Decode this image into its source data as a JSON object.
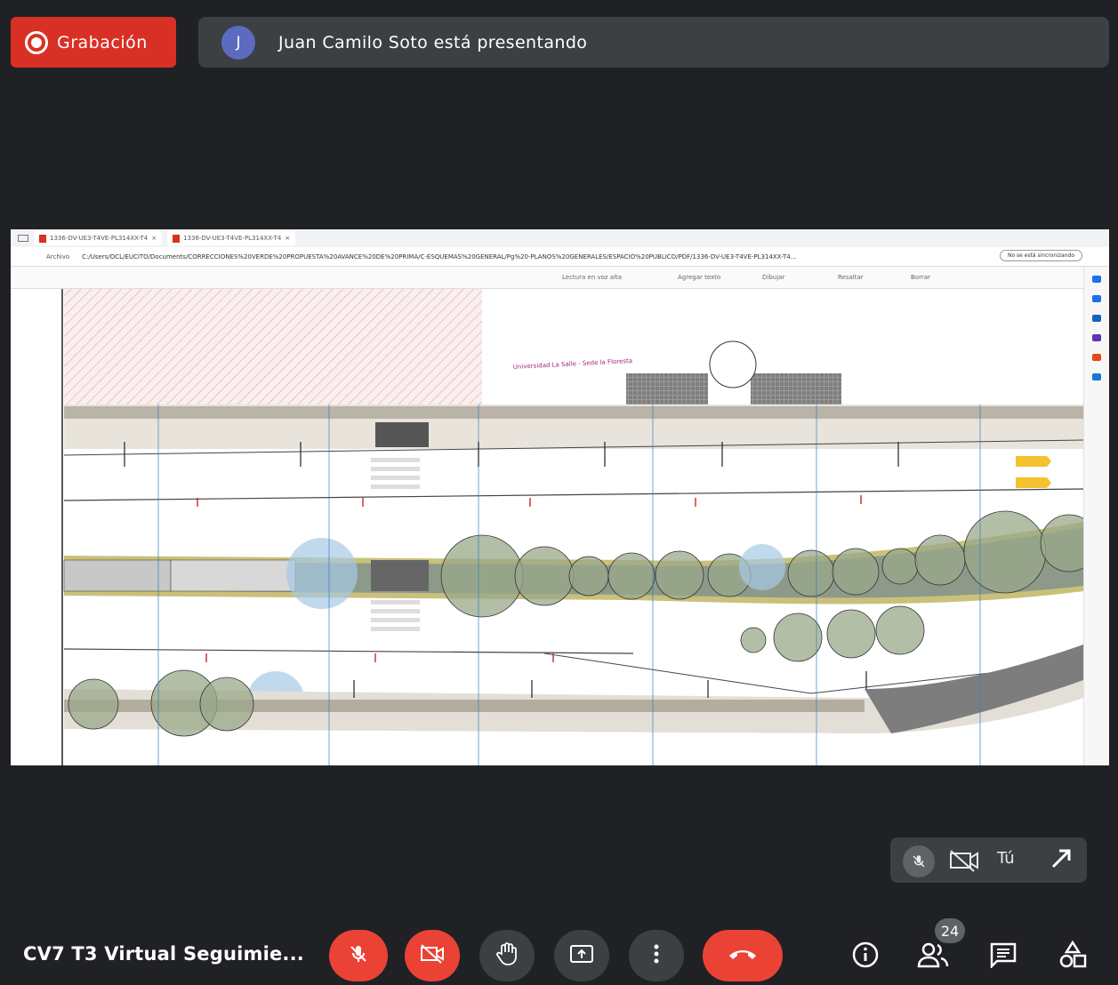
{
  "recording": {
    "label": "Grabación"
  },
  "presenter": {
    "avatar_letter": "J",
    "text": "Juan Camilo Soto está presentando"
  },
  "shared_screen": {
    "tabs": [
      {
        "label": "1336-DV-UE3-T4VE-PL314XX-T4"
      },
      {
        "label": "1336-DV-UE3-T4VE-PL314XX-T4"
      }
    ],
    "address": {
      "scheme": "Archivo",
      "url": "C:/Users/OCL/EUCITO/Documents/CORRECCIONES%20VERDE%20PROPUESTA%20AVANCE%20DE%20PRIMA/C-ESQUEMAS%20GENERAL/Pg%20-PLANOS%20GENERALES/ESPACIO%20PUBLICO/PDF/1336-DV-UE3-T4VE-PL314XX-T4..."
    },
    "reading_mode": "No se está sincronizando",
    "pdf_toolbar": {
      "read_aloud": "Lectura en voz alta",
      "add_text": "Agregar texto",
      "draw": "Dibujar",
      "highlight": "Resaltar",
      "erase": "Borrar"
    },
    "drawing_annotation": "Universidad La Salle - Sede la Floresta"
  },
  "self_view": {
    "label": "Tú"
  },
  "meeting": {
    "title": "CV7 T3 Virtual Seguimie..."
  },
  "participants": {
    "count": "24"
  },
  "colors": {
    "record": "#d93025",
    "end_call": "#ea4335",
    "control_bg": "#3c4043"
  },
  "icons": [
    "record-icon",
    "mic-off-icon",
    "camera-off-icon",
    "raise-hand-icon",
    "present-icon",
    "more-options-icon",
    "end-call-icon",
    "info-icon",
    "people-icon",
    "chat-icon",
    "activities-icon",
    "expand-icon"
  ]
}
